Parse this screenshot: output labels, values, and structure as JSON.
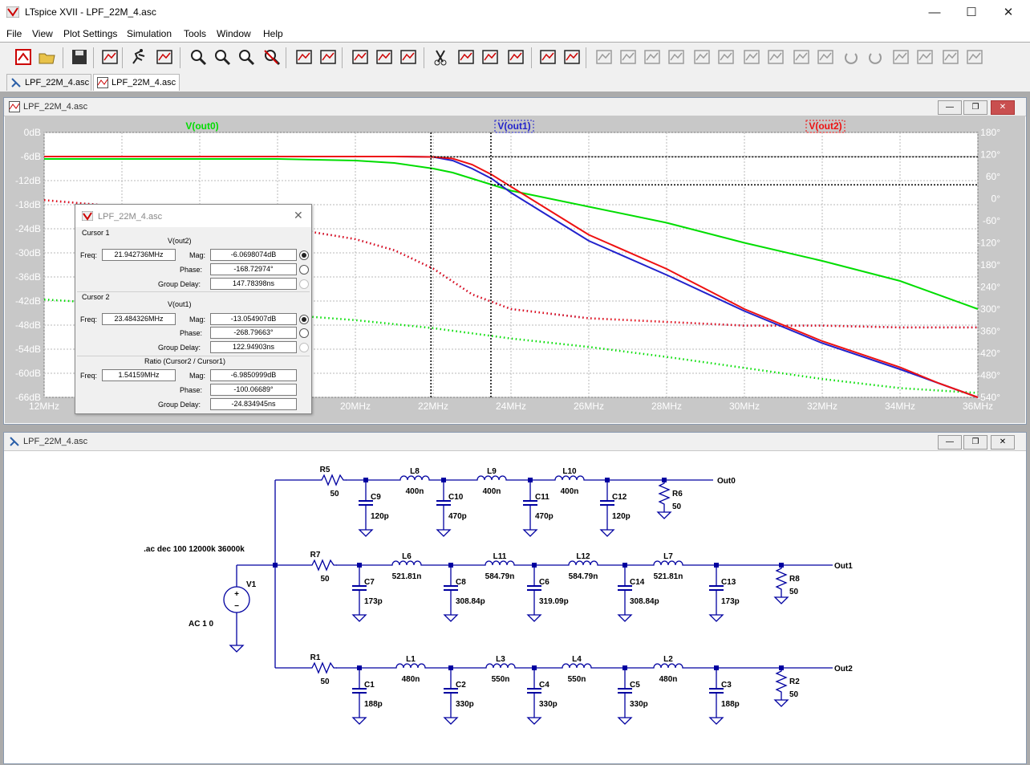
{
  "window": {
    "title": "LTspice XVII - LPF_22M_4.asc",
    "min": "—",
    "max": "☐",
    "close": "✕"
  },
  "menu": [
    "File",
    "View",
    "Plot Settings",
    "Simulation",
    "Tools",
    "Window",
    "Help"
  ],
  "toolbar_icons": [
    "new-schematic-icon",
    "open-icon",
    "save-icon",
    "control-panel-icon",
    "run-icon",
    "halt-icon",
    "zoom-in-icon",
    "zoom-out-icon",
    "zoom-fit-icon",
    "zoom-cancel-icon",
    "autorange-icon",
    "plot-icon",
    "tile-h-icon",
    "tile-v-icon",
    "cascade-icon",
    "cut-icon",
    "copy-icon",
    "paste-icon",
    "find-icon",
    "print-icon",
    "print-setup-icon",
    "wire-icon",
    "ground-icon",
    "label-icon",
    "resistor-icon",
    "capacitor-icon",
    "inductor-icon",
    "diode-icon",
    "component-icon",
    "move-icon",
    "drag-icon",
    "undo-icon",
    "redo-icon",
    "rotate-icon",
    "mirror-icon",
    "text-icon",
    "spice-directive-icon"
  ],
  "tabs": [
    "LPF_22M_4.asc",
    "LPF_22M_4.asc"
  ],
  "plot_window": {
    "title": "LPF_22M_4.asc"
  },
  "schematic_window": {
    "title": "LPF_22M_4.asc"
  },
  "chart_data": {
    "type": "line",
    "x_axis": {
      "min": 12,
      "max": 36,
      "unit": "MHz",
      "ticks": [
        "12MHz",
        "14MHz",
        "16MHz",
        "18MHz",
        "20MHz",
        "22MHz",
        "24MHz",
        "26MHz",
        "28MHz",
        "30MHz",
        "32MHz",
        "34MHz",
        "36MHz"
      ]
    },
    "y_axis_left": {
      "min": -66,
      "max": 0,
      "ticks": [
        "0dB",
        "-6dB",
        "-12dB",
        "-18dB",
        "-24dB",
        "-30dB",
        "-36dB",
        "-42dB",
        "-48dB",
        "-54dB",
        "-60dB",
        "-66dB"
      ]
    },
    "y_axis_right": {
      "min": -540,
      "max": 180,
      "ticks": [
        "180°",
        "120°",
        "60°",
        "0°",
        "-60°",
        "-120°",
        "-180°",
        "-240°",
        "-300°",
        "-360°",
        "-420°",
        "-480°",
        "-540°"
      ]
    },
    "grid": true,
    "series": [
      {
        "name": "V(out0)",
        "color": "#00dd00",
        "x": [
          12,
          14,
          16,
          18,
          20,
          21,
          22,
          22.5,
          23,
          24,
          26,
          28,
          30,
          32,
          34,
          36
        ],
        "mag": [
          -6.6,
          -6.6,
          -6.6,
          -6.6,
          -7.0,
          -7.6,
          -9,
          -10,
          -11.5,
          -14.5,
          -18.5,
          -22.5,
          -27.5,
          -32,
          -37,
          -44
        ],
        "phase_x": [
          12,
          14,
          16,
          18,
          20,
          22,
          24,
          26,
          28,
          30,
          32,
          34,
          36
        ],
        "phase": [
          -274,
          -287,
          -300,
          -314,
          -330,
          -352,
          -380,
          -403,
          -430,
          -460,
          -490,
          -515,
          -528
        ]
      },
      {
        "name": "V(out1)",
        "color": "#2222cc",
        "x": [
          12,
          14,
          16,
          18,
          20,
          21,
          22,
          22.5,
          23,
          23.5,
          24,
          25,
          26,
          28,
          30,
          32,
          34,
          35,
          36
        ],
        "mag": [
          -6,
          -6,
          -6,
          -6,
          -6,
          -6,
          -6.1,
          -7,
          -9,
          -11.5,
          -15,
          -21,
          -27,
          -35.5,
          -44.5,
          -52.5,
          -59,
          -62.5,
          -66
        ],
        "phase_x": [
          12,
          14,
          16,
          18,
          20,
          21,
          22,
          23,
          24,
          26,
          28,
          30,
          32,
          34,
          36
        ],
        "phase": [
          -4,
          -22,
          -45,
          -75,
          -110,
          -140,
          -190,
          -260,
          -300,
          -325,
          -335,
          -345,
          -345,
          -350,
          -350
        ]
      },
      {
        "name": "V(out2)",
        "color": "#ee1111",
        "x": [
          12,
          14,
          16,
          18,
          20,
          21,
          22,
          22.5,
          23,
          23.5,
          24,
          25,
          26,
          28,
          30,
          32,
          34,
          35,
          36
        ],
        "mag": [
          -6,
          -6,
          -6,
          -6,
          -6,
          -6,
          -6.1,
          -6.5,
          -8,
          -10.5,
          -13.5,
          -19.5,
          -25.5,
          -34,
          -44,
          -52,
          -58.5,
          -62.5,
          -66
        ],
        "phase_x": [
          12,
          14,
          16,
          18,
          20,
          21,
          22,
          23,
          24,
          26,
          28,
          30,
          32,
          34,
          36
        ],
        "phase": [
          -4,
          -22,
          -45,
          -75,
          -110,
          -140,
          -190,
          -260,
          -300,
          -325,
          -335,
          -345,
          -345,
          -350,
          -350
        ]
      }
    ],
    "cursors": [
      {
        "x": 21.942736,
        "y_db": -6.07
      },
      {
        "x": 23.484326,
        "y_db": -13.05
      }
    ]
  },
  "cursor_dialog": {
    "title": "LPF_22M_4.asc",
    "cursor1": {
      "label": "Cursor 1",
      "trace": "V(out2)",
      "freq_label": "Freq:",
      "freq": "21.942736MHz",
      "mag_label": "Mag:",
      "mag": "-6.0698074dB",
      "phase_label": "Phase:",
      "phase": "-168.72974°",
      "gd_label": "Group Delay:",
      "gd": "147.78398ns"
    },
    "cursor2": {
      "label": "Cursor 2",
      "trace": "V(out1)",
      "freq_label": "Freq:",
      "freq": "23.484326MHz",
      "mag_label": "Mag:",
      "mag": "-13.054907dB",
      "phase_label": "Phase:",
      "phase": "-268.79663°",
      "gd_label": "Group Delay:",
      "gd": "122.94903ns"
    },
    "ratio": {
      "label": "Ratio (Cursor2 / Cursor1)",
      "freq_label": "Freq:",
      "freq": "1.54159MHz",
      "mag_label": "Mag:",
      "mag": "-6.9850999dB",
      "phase_label": "Phase:",
      "phase": "-100.06689°",
      "gd_label": "Group Delay:",
      "gd": "-24.834945ns"
    }
  },
  "schematic": {
    "directive": ".ac dec 100 12000k 36000k",
    "source": {
      "name": "V1",
      "value": "AC 1 0"
    },
    "row0": {
      "out": "Out0",
      "R_in": {
        "name": "R5",
        "value": "50"
      },
      "L": [
        {
          "name": "L8",
          "value": "400n"
        },
        {
          "name": "L9",
          "value": "400n"
        },
        {
          "name": "L10",
          "value": "400n"
        }
      ],
      "C": [
        {
          "name": "C9",
          "value": "120p"
        },
        {
          "name": "C10",
          "value": "470p"
        },
        {
          "name": "C11",
          "value": "470p"
        },
        {
          "name": "C12",
          "value": "120p"
        }
      ],
      "R_load": {
        "name": "R6",
        "value": "50"
      }
    },
    "row1": {
      "out": "Out1",
      "R_in": {
        "name": "R7",
        "value": "50"
      },
      "L": [
        {
          "name": "L6",
          "value": "521.81n"
        },
        {
          "name": "L11",
          "value": "584.79n"
        },
        {
          "name": "L12",
          "value": "584.79n"
        },
        {
          "name": "L7",
          "value": "521.81n"
        }
      ],
      "C": [
        {
          "name": "C7",
          "value": "173p"
        },
        {
          "name": "C8",
          "value": "308.84p"
        },
        {
          "name": "C6",
          "value": "319.09p"
        },
        {
          "name": "C14",
          "value": "308.84p"
        },
        {
          "name": "C13",
          "value": "173p"
        }
      ],
      "R_load": {
        "name": "R8",
        "value": "50"
      }
    },
    "row2": {
      "out": "Out2",
      "R_in": {
        "name": "R1",
        "value": "50"
      },
      "L": [
        {
          "name": "L1",
          "value": "480n"
        },
        {
          "name": "L3",
          "value": "550n"
        },
        {
          "name": "L4",
          "value": "550n"
        },
        {
          "name": "L2",
          "value": "480n"
        }
      ],
      "C": [
        {
          "name": "C1",
          "value": "188p"
        },
        {
          "name": "C2",
          "value": "330p"
        },
        {
          "name": "C4",
          "value": "330p"
        },
        {
          "name": "C5",
          "value": "330p"
        },
        {
          "name": "C3",
          "value": "188p"
        }
      ],
      "R_load": {
        "name": "R2",
        "value": "50"
      }
    }
  }
}
